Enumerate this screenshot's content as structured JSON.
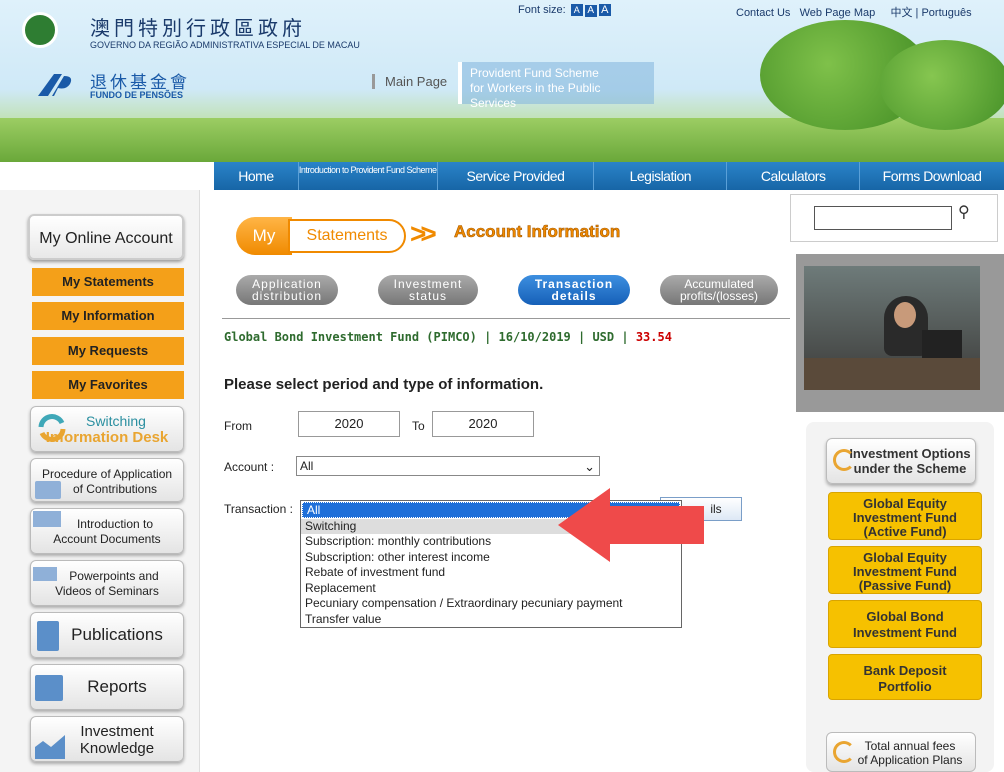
{
  "header": {
    "gov_zh": "澳門特別行政區政府",
    "gov_pt": "GOVERNO DA REGIÃO ADMINISTRATIVA ESPECIAL DE MACAU",
    "fund_zh": "退休基金會",
    "fund_pt": "FUNDO DE PENSÕES",
    "main_page": "Main Page",
    "scheme_line1": "Provident Fund Scheme",
    "scheme_line2": "for Workers in the Public Services",
    "font_size_label": "Font size:",
    "font_btn": "A",
    "contact": "Contact Us",
    "webmap": "Web Page Map",
    "lang": "中文 | Português"
  },
  "nav": [
    "Home",
    "Introduction to Provident Fund Scheme",
    "Service Provided",
    "Legislation",
    "Calculators",
    "Forms Download"
  ],
  "sidebar": {
    "online_account": "My Online Account",
    "statements": "My Statements",
    "information": "My Information",
    "requests": "My Requests",
    "favorites": "My Favorites",
    "switching_1": "Switching",
    "switching_2": "Information Desk",
    "procedure_1": "Procedure of Application",
    "procedure_2": "of Contributions",
    "intro_1": "Introduction to",
    "intro_2": "Account Documents",
    "ppt_1": "Powerpoints and",
    "ppt_2": "Videos of Seminars",
    "publications": "Publications",
    "reports": "Reports",
    "inv_1": "Investment",
    "inv_2": "Knowledge"
  },
  "crumbs": {
    "my": "My",
    "statements": "Statements",
    "arrow": ">>",
    "account": "Account Information"
  },
  "tabs": [
    {
      "l1": "Application",
      "l2": "distribution"
    },
    {
      "l1": "Investment",
      "l2": "status"
    },
    {
      "l1": "Transaction",
      "l2": "details"
    },
    {
      "l1": "Accumulated",
      "l2": "profits/(losses)"
    }
  ],
  "fund": {
    "info": "Global Bond Investment Fund (PIMCO) | 16/10/2019 | USD | ",
    "price": "33.54"
  },
  "form": {
    "title": "Please select period and type of information.",
    "from_label": "From",
    "from_value": "2020",
    "to_label": "To",
    "to_value": "2020",
    "account_label": "Account :",
    "account_value": "All",
    "transaction_label": "Transaction :",
    "details_btn": "ils",
    "options": [
      "All",
      "Switching",
      "Subscription: monthly contributions",
      "Subscription: other interest income",
      "Rebate of investment fund",
      "Replacement",
      "Pecuniary compensation / Extraordinary pecuniary payment",
      "Transfer value"
    ]
  },
  "right": {
    "inv_options_1": "Investment Options",
    "inv_options_2": "under the Scheme",
    "geaf_1": "Global Equity",
    "geaf_2": "Investment Fund",
    "geaf_3": "(Active Fund)",
    "gepf_1": "Global Equity",
    "gepf_2": "Investment Fund",
    "gepf_3": "(Passive Fund)",
    "gb_1": "Global Bond",
    "gb_2": "Investment Fund",
    "bd_1": "Bank Deposit",
    "bd_2": "Portfolio",
    "fees_1": "Total annual fees",
    "fees_2": "of Application Plans"
  },
  "colors": {
    "accent_orange": "#f08a00",
    "nav_blue": "#1765a6",
    "selected_blue": "#1e6fd9",
    "arrow_red": "#ef4a4a"
  }
}
